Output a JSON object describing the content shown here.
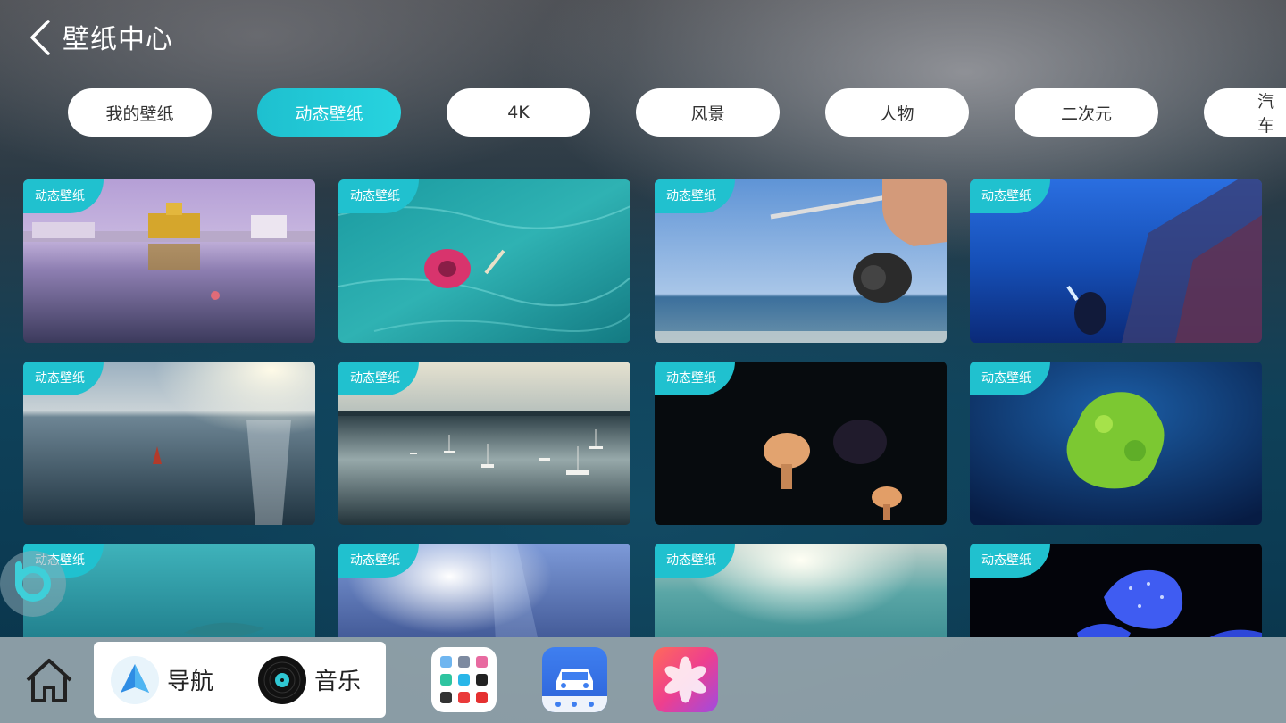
{
  "header": {
    "title": "壁纸中心"
  },
  "tabs": [
    {
      "label": "我的壁纸",
      "active": false
    },
    {
      "label": "动态壁纸",
      "active": true
    },
    {
      "label": "4K",
      "active": false
    },
    {
      "label": "风景",
      "active": false
    },
    {
      "label": "人物",
      "active": false
    },
    {
      "label": "二次元",
      "active": false
    },
    {
      "label": "汽车",
      "active": false
    }
  ],
  "wallpapers": [
    {
      "badge": "动态壁纸",
      "scene": "golden-temple-reflection"
    },
    {
      "badge": "动态壁纸",
      "scene": "pink-float-in-pool"
    },
    {
      "badge": "动态壁纸",
      "scene": "fishing-rod-at-sea"
    },
    {
      "badge": "动态壁纸",
      "scene": "diver-by-shipwreck"
    },
    {
      "badge": "动态壁纸",
      "scene": "sailboat-at-sunset"
    },
    {
      "badge": "动态壁纸",
      "scene": "sailboats-on-lake"
    },
    {
      "badge": "动态壁纸",
      "scene": "jellyfish-dark"
    },
    {
      "badge": "动态壁纸",
      "scene": "green-coral-underwater"
    },
    {
      "badge": "动态壁纸",
      "scene": "aquarium-blue"
    },
    {
      "badge": "动态壁纸",
      "scene": "underwater-light"
    },
    {
      "badge": "动态壁纸",
      "scene": "ocean-waves-sunlight"
    },
    {
      "badge": "动态壁纸",
      "scene": "glowing-blue-jellyfish"
    }
  ],
  "dock": {
    "nav_label": "导航",
    "music_label": "音乐",
    "apps": [
      "app-grid-icon",
      "car-service-icon",
      "photos-icon"
    ]
  },
  "colors": {
    "accent": "#20c1cf",
    "dock": "#96a5ac"
  }
}
